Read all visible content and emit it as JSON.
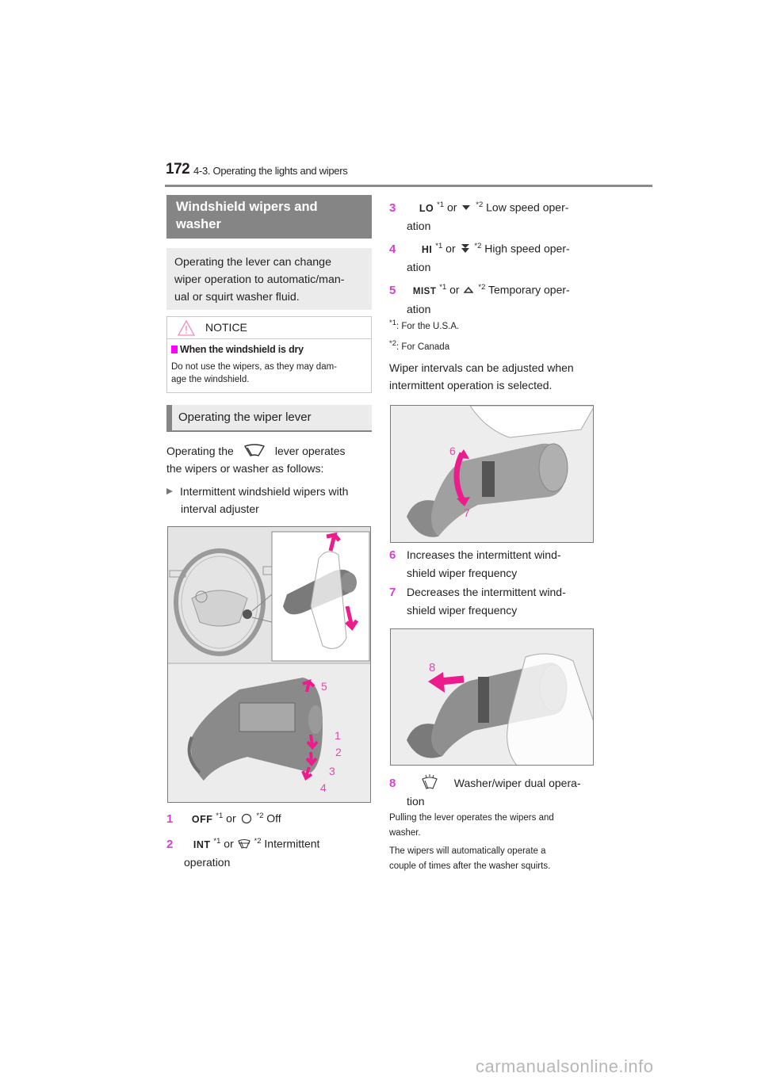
{
  "header": {
    "page_number": "172",
    "section": "4-3. Operating the lights and wipers"
  },
  "left": {
    "main_heading_line1": "Windshield wipers and",
    "main_heading_line2": "washer",
    "intro_line1": "Operating the lever can change",
    "intro_line2": "wiper operation to automatic/man-",
    "intro_line3": "ual or squirt washer fluid.",
    "notice": {
      "label": "NOTICE",
      "subheading": "When the windshield is dry",
      "text_line1": "Do not use the wipers, as they may dam-",
      "text_line2": "age the windshield."
    },
    "sub_heading": "Operating the wiper lever",
    "para_before": "Operating the",
    "para_after": "lever operates",
    "para_line2": "the wipers or washer as follows:",
    "bullet_line1": "Intermittent windshield wipers with",
    "bullet_line2": "interval adjuster",
    "figure1_callouts": [
      "5",
      "1",
      "2",
      "3",
      "4"
    ],
    "items": [
      {
        "num": "1",
        "code": "OFF",
        "sup1": "*1",
        "or": "or",
        "sup2": "*2",
        "desc": "Off",
        "icon": "circle-icon"
      },
      {
        "num": "2",
        "code": "INT",
        "sup1": "*1",
        "or": "or",
        "sup2": "*2",
        "desc": "Intermittent",
        "desc2": "operation",
        "icon": "intermittent-wiper-icon"
      }
    ]
  },
  "right": {
    "items": [
      {
        "num": "3",
        "code": "LO",
        "sup1": "*1",
        "or": "or",
        "sup2": "*2",
        "desc": "Low speed oper-",
        "desc2": "ation",
        "icon": "single-down-triangle-icon"
      },
      {
        "num": "4",
        "code": "HI",
        "sup1": "*1",
        "or": "or",
        "sup2": "*2",
        "desc": "High speed oper-",
        "desc2": "ation",
        "icon": "double-down-triangle-icon"
      },
      {
        "num": "5",
        "code": "MIST",
        "sup1": "*1",
        "or": "or",
        "sup2": "*2",
        "desc": "Temporary oper-",
        "desc2": "ation",
        "icon": "up-triangle-icon"
      }
    ],
    "footnotes": [
      {
        "mark": "*1",
        "text": ":  For the U.S.A."
      },
      {
        "mark": "*2",
        "text": ": For Canada"
      }
    ],
    "interval_line1": "Wiper intervals can be adjusted when",
    "interval_line2": "intermittent operation is selected.",
    "figure2_callouts": [
      "6",
      "7"
    ],
    "items2": [
      {
        "num": "6",
        "line1": "Increases the intermittent wind-",
        "line2": "shield wiper frequency"
      },
      {
        "num": "7",
        "line1": "Decreases the intermittent wind-",
        "line2": "shield wiper frequency"
      }
    ],
    "figure3_callouts": [
      "8"
    ],
    "item8": {
      "num": "8",
      "desc": "Washer/wiper dual opera-",
      "desc2": "tion",
      "icon": "washer-wiper-icon"
    },
    "note1_line1": "Pulling the lever operates the wipers and",
    "note1_line2": "washer.",
    "note2_line1": "The wipers will automatically operate a",
    "note2_line2": "couple of times after the washer squirts."
  },
  "watermark": "carmanualsonline.info",
  "colors": {
    "accent_magenta": "#d63fcf",
    "arrow_magenta": "#ec1c8c",
    "heading_grey": "#858585",
    "box_grey": "#ebebeb"
  }
}
